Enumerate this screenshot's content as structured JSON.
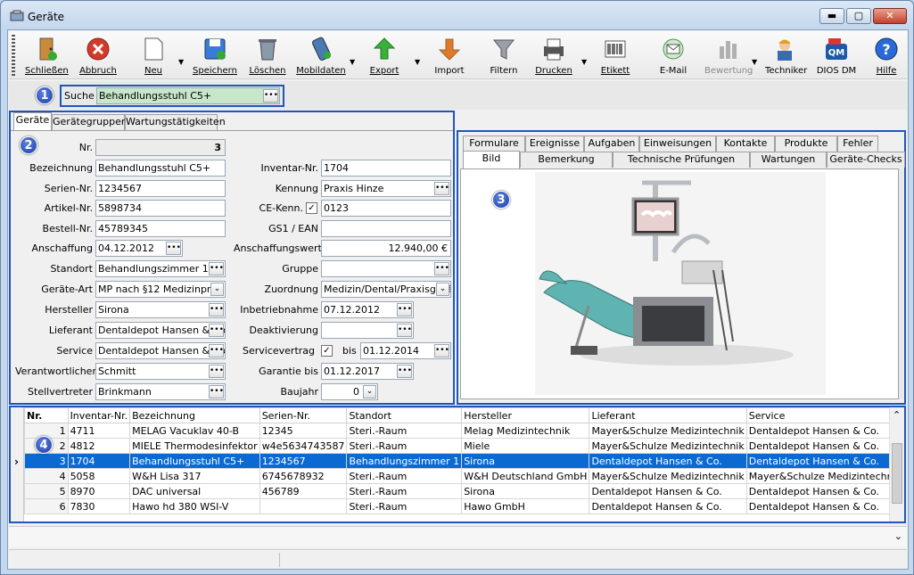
{
  "window": {
    "title": "Geräte",
    "min": "▬",
    "max": "▢",
    "close": "✕"
  },
  "toolbar": [
    {
      "id": "schliessen",
      "label": "Schließen",
      "icon": "exit-door-icon",
      "color": "#c98a3a"
    },
    {
      "id": "abbruch",
      "label": "Abbruch",
      "icon": "cancel-icon",
      "color": "#d23a2a"
    },
    {
      "id": "neu",
      "label": "Neu",
      "icon": "new-document-icon",
      "color": "#ffffff"
    },
    {
      "id": "speichern",
      "label": "Speichern",
      "icon": "save-icon",
      "color": "#3a7ad8"
    },
    {
      "id": "loeschen",
      "label": "Löschen",
      "icon": "trash-icon",
      "color": "#8a9aa8"
    },
    {
      "id": "mobildaten",
      "label": "Mobildaten",
      "icon": "mobile-device-icon",
      "color": "#4a7ab0"
    },
    {
      "id": "export",
      "label": "Export",
      "icon": "export-arrow-icon",
      "color": "#3ab03a"
    },
    {
      "id": "import",
      "label": "Import",
      "icon": "import-arrow-icon",
      "color": "#e07a2a"
    },
    {
      "id": "filtern",
      "label": "Filtern",
      "icon": "filter-funnel-icon",
      "color": "#9aa0a8"
    },
    {
      "id": "drucken",
      "label": "Drucken",
      "icon": "printer-icon",
      "color": "#555555"
    },
    {
      "id": "etikett",
      "label": "Etikett",
      "icon": "barcode-label-icon",
      "color": "#222222"
    },
    {
      "id": "email",
      "label": "E-Mail",
      "icon": "email-icon",
      "color": "#4a9a4a"
    },
    {
      "id": "bewertung",
      "label": "Bewertung",
      "icon": "rating-chart-icon",
      "color": "#b0b0b0"
    },
    {
      "id": "techniker",
      "label": "Techniker",
      "icon": "technician-icon",
      "color": "#e0a020"
    },
    {
      "id": "diosdm",
      "label": "DIOS DM",
      "icon": "dios-qm-icon",
      "color": "#1a5aa8"
    },
    {
      "id": "hilfe",
      "label": "Hilfe",
      "icon": "help-icon",
      "color": "#2a6ad8"
    }
  ],
  "search": {
    "label": "Suche",
    "value": "Behandlungsstuhl C5+"
  },
  "badges": [
    "1",
    "2",
    "3",
    "4"
  ],
  "left_tabs": [
    "Geräte",
    "Gerätegruppen",
    "Wartungstätigkeiten"
  ],
  "form": {
    "nr_label": "Nr.",
    "nr": "3",
    "bezeichnung_label": "Bezeichnung",
    "bezeichnung": "Behandlungsstuhl C5+",
    "serien_label": "Serien-Nr.",
    "serien": "1234567",
    "artikel_label": "Artikel-Nr.",
    "artikel": "5898734",
    "bestell_label": "Bestell-Nr.",
    "bestell": "45789345",
    "anschaffung_label": "Anschaffung",
    "anschaffung": "04.12.2012",
    "standort_label": "Standort",
    "standort": "Behandlungszimmer 1",
    "geraeteart_label": "Geräte-Art",
    "geraeteart": "MP nach §12 Medizinproc",
    "hersteller_label": "Hersteller",
    "hersteller": "Sirona",
    "lieferant_label": "Lieferant",
    "lieferant": "Dentaldepot Hansen & Co.",
    "service_label": "Service",
    "service": "Dentaldepot Hansen & Co.",
    "verantw_label": "Verantwortlicher",
    "verantw": "Schmitt",
    "stellv_label": "Stellvertreter",
    "stellv": "Brinkmann",
    "inventar_label": "Inventar-Nr.",
    "inventar": "1704",
    "kennung_label": "Kennung",
    "kennung": "Praxis Hinze",
    "ce_label": "CE-Kenn.",
    "ce": "0123",
    "gs1_label": "GS1 / EAN",
    "gs1": "",
    "wert_label": "Anschaffungswert",
    "wert": "12.940,00 €",
    "gruppe_label": "Gruppe",
    "gruppe": "",
    "zuordnung_label": "Zuordnung",
    "zuordnung": "Medizin/Dental/Praxisgerä",
    "inbetrieb_label": "Inbetriebnahme",
    "inbetrieb": "07.12.2012",
    "deakt_label": "Deaktivierung",
    "deakt": "",
    "servicevertrag_label": "Servicevertrag",
    "bis_label": "bis",
    "servicevertrag_bis": "01.12.2014",
    "garantie_label": "Garantie bis",
    "garantie": "01.12.2017",
    "baujahr_label": "Baujahr",
    "baujahr": "0",
    "dots": "•••",
    "check": "✓",
    "chevron": "⌄"
  },
  "right_tabs_row1": [
    "Formulare",
    "Ereignisse",
    "Aufgaben",
    "Einweisungen",
    "Kontakte",
    "Produkte",
    "Fehler"
  ],
  "right_tabs_row2": [
    "Bild",
    "Bemerkung",
    "Technische Prüfungen",
    "Wartungen",
    "Geräte-Checks"
  ],
  "grid": {
    "headers": [
      "Nr.",
      "Inventar-Nr.",
      "Bezeichnung",
      "Serien-Nr.",
      "Standort",
      "Hersteller",
      "Lieferant",
      "Service"
    ],
    "rows": [
      [
        "1",
        "4711",
        "MELAG Vacuklav 40-B",
        "12345",
        "Steri.-Raum",
        "Melag Medizintechnik",
        "Mayer&Schulze Medizintechnik",
        "Dentaldepot Hansen & Co."
      ],
      [
        "2",
        "4812",
        "MIELE Thermodesinfektor",
        "w4e5634743587",
        "Steri.-Raum",
        "Miele",
        "Mayer&Schulze Medizintechnik",
        "Dentaldepot Hansen & Co."
      ],
      [
        "3",
        "1704",
        "Behandlungsstuhl C5+",
        "1234567",
        "Behandlungszimmer 1",
        "Sirona",
        "Dentaldepot Hansen & Co.",
        "Dentaldepot Hansen & Co."
      ],
      [
        "4",
        "5058",
        "W&H Lisa 317",
        "6745678932",
        "Steri.-Raum",
        "W&H Deutschland GmbH",
        "Mayer&Schulze Medizintechnik",
        "Mayer&Schulze Medizintechnik"
      ],
      [
        "5",
        "8970",
        "DAC universal",
        "456789",
        "Steri.-Raum",
        "Sirona",
        "Dentaldepot Hansen & Co.",
        "Dentaldepot Hansen & Co."
      ],
      [
        "6",
        "7830",
        "Hawo hd 380 WSI-V",
        "",
        "Steri.-Raum",
        "Hawo GmbH",
        "Dentaldepot Hansen & Co.",
        "Dentaldepot Hansen & Co."
      ]
    ],
    "selected_row": 2,
    "row_pointer": "›",
    "scroll_up": "⌃",
    "scroll_down": "⌄"
  },
  "colors": {
    "accent": "#1f57b8",
    "selection": "#0a6ad2",
    "search_bg": "#c8e6c9"
  }
}
